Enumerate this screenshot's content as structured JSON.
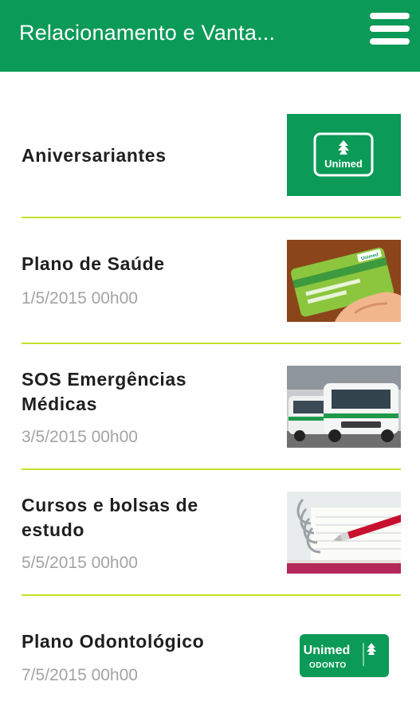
{
  "appbar": {
    "title": "Relacionamento e Vanta...",
    "menu_icon": "hamburger-menu-icon",
    "color": "#0b9a57"
  },
  "list": {
    "divider_color": "#c5e02a",
    "items": [
      {
        "title": "Aniversariantes",
        "date": "",
        "thumbnail": "unimed-logo"
      },
      {
        "title": "Plano de Saúde",
        "date": "1/5/2015 00h00",
        "thumbnail": "health-card-photo"
      },
      {
        "title": "SOS Emergências Médicas",
        "date": "3/5/2015 00h00",
        "thumbnail": "ambulance-photo"
      },
      {
        "title": "Cursos e bolsas de estudo",
        "date": "5/5/2015 00h00",
        "thumbnail": "notebook-pen-photo"
      },
      {
        "title": "Plano Odontológico",
        "date": "7/5/2015 00h00",
        "thumbnail": "unimed-odonto-logo"
      }
    ]
  },
  "logos": {
    "unimed": "Unimed",
    "odonto": "ODONTO",
    "card_brand": "Unimed"
  }
}
